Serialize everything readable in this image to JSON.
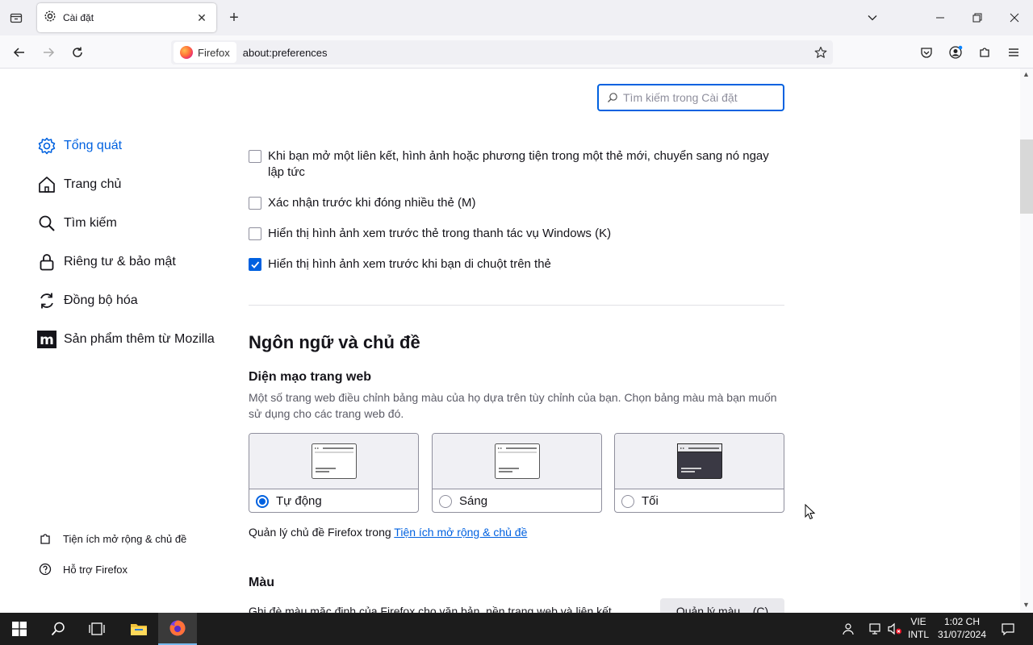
{
  "browser": {
    "tab_title": "Cài đặt",
    "identity_label": "Firefox",
    "url": "about:preferences"
  },
  "search": {
    "placeholder": "Tìm kiếm trong Cài đặt"
  },
  "sidebar": {
    "items": [
      {
        "label": "Tổng quát",
        "icon": "gear-icon",
        "active": true
      },
      {
        "label": "Trang chủ",
        "icon": "home-icon"
      },
      {
        "label": "Tìm kiếm",
        "icon": "search-icon"
      },
      {
        "label": "Riêng tư & bảo mật",
        "icon": "lock-icon"
      },
      {
        "label": "Đồng bộ hóa",
        "icon": "sync-icon"
      },
      {
        "label": "Sản phẩm thêm từ Mozilla",
        "icon": "mozilla-icon"
      }
    ],
    "footer": [
      {
        "label": "Tiện ích mở rộng & chủ đề",
        "icon": "puzzle-icon"
      },
      {
        "label": "Hỗ trợ Firefox",
        "icon": "help-icon"
      }
    ]
  },
  "tabs_settings": {
    "options": [
      {
        "label": "Khi bạn mở một liên kết, hình ảnh hoặc phương tiện trong một thẻ mới, chuyển sang nó ngay lập tức",
        "checked": false
      },
      {
        "label": "Xác nhận trước khi đóng nhiều thẻ (M)",
        "checked": false
      },
      {
        "label": "Hiển thị hình ảnh xem trước thẻ trong thanh tác vụ Windows (K)",
        "checked": false
      },
      {
        "label": "Hiển thị hình ảnh xem trước khi bạn di chuột trên thẻ",
        "checked": true
      }
    ]
  },
  "language_theme": {
    "heading": "Ngôn ngữ và chủ đề",
    "appearance_heading": "Diện mạo trang web",
    "appearance_desc": "Một số trang web điều chỉnh bảng màu của họ dựa trên tùy chỉnh của bạn. Chọn bảng màu mà bạn muốn sử dụng cho các trang web đó.",
    "themes": [
      {
        "label": "Tự động",
        "selected": true
      },
      {
        "label": "Sáng",
        "selected": false
      },
      {
        "label": "Tối",
        "selected": false
      }
    ],
    "manage_prefix": "Quản lý chủ đề Firefox trong ",
    "manage_link": "Tiện ích mở rộng & chủ đề",
    "colors_heading": "Màu",
    "colors_desc": "Ghi đè màu mặc định của Firefox cho văn bản, nền trang web và liên kết.",
    "colors_button": "Quản lý màu... (C)"
  },
  "taskbar": {
    "lang_line1": "VIE",
    "lang_line2": "INTL",
    "time": "1:02 CH",
    "date": "31/07/2024"
  },
  "colors": {
    "accent": "#0061e0",
    "tab_strip": "#f0f0f4",
    "taskbar": "#1c1c1c"
  }
}
